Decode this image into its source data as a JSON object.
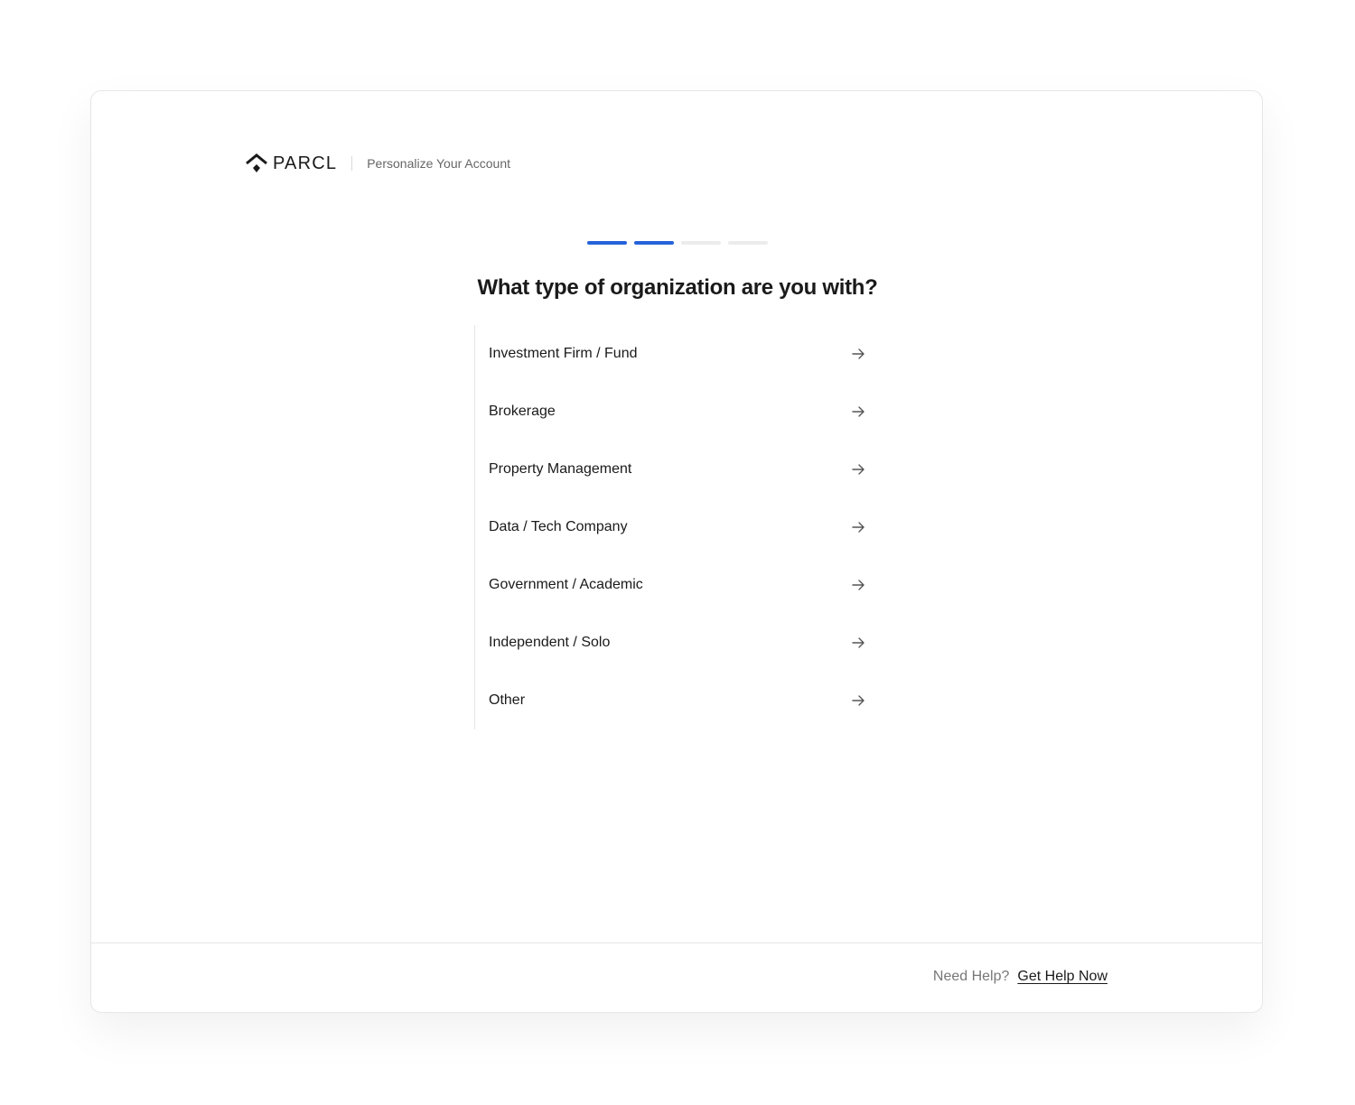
{
  "header": {
    "logo_text": "PARCL",
    "subtitle": "Personalize Your Account"
  },
  "progress": {
    "total_steps": 4,
    "completed_steps": 2,
    "active_color": "#2563d9",
    "inactive_color": "#ececec"
  },
  "question": "What type of organization are you with?",
  "options": [
    {
      "label": "Investment Firm / Fund",
      "icon": "arrow-right-icon"
    },
    {
      "label": "Brokerage",
      "icon": "arrow-right-icon"
    },
    {
      "label": "Property Management",
      "icon": "arrow-right-icon"
    },
    {
      "label": "Data / Tech Company",
      "icon": "arrow-right-icon"
    },
    {
      "label": "Government / Academic",
      "icon": "arrow-right-icon"
    },
    {
      "label": "Independent / Solo",
      "icon": "arrow-right-icon"
    },
    {
      "label": "Other",
      "icon": "arrow-right-icon"
    }
  ],
  "footer": {
    "help_text": "Need Help?",
    "help_link": "Get Help Now"
  }
}
